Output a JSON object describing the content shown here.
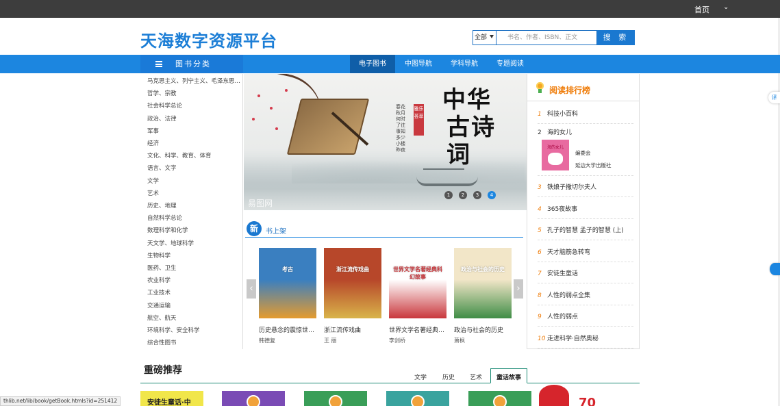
{
  "topbar": {
    "home_label": "首页",
    "menu_chevron": "⌄"
  },
  "header": {
    "logo_text": "天海数字资源平台"
  },
  "search": {
    "scope_value": "全部",
    "placeholder": "书名、作者、ISBN、正文",
    "button_label": "搜 索"
  },
  "nav": {
    "category_label": "图书分类",
    "tabs": [
      {
        "label": "电子图书",
        "active": true
      },
      {
        "label": "中图导航",
        "active": false
      },
      {
        "label": "学科导航",
        "active": false
      },
      {
        "label": "专题阅读",
        "active": false
      }
    ]
  },
  "categories": [
    "马克思主义、列宁主义、毛泽东思想、邓小平理论",
    "哲学、宗教",
    "社会科学总论",
    "政治、法律",
    "军事",
    "经济",
    "文化、科学、教育、体育",
    "语言、文字",
    "文学",
    "艺术",
    "历史、地理",
    "自然科学总论",
    "数理科学和化学",
    "天文学、地球科学",
    "生物科学",
    "医药、卫生",
    "农业科学",
    "工业技术",
    "交通运输",
    "航空、航天",
    "环境科学、安全科学",
    "综合性图书"
  ],
  "banner": {
    "title_line1": "中华",
    "title_line2": "古诗",
    "title_line3": "词",
    "seal_text": "雅乐荟萃",
    "side_text": "春花秋月何时了往事知多少小楼昨夜",
    "watermark": "昜图网",
    "slides": [
      "1",
      "2",
      "3",
      "4"
    ],
    "active_slide": 4
  },
  "new_books": {
    "badge": "新",
    "label": "书上架",
    "prev": "‹",
    "next": "›",
    "items": [
      {
        "title": "历史悬念的震惊世界的考古发现",
        "author": "韩德复",
        "cover_text": "考古",
        "colors": [
          "#3a7fc0",
          "#e59b2e"
        ]
      },
      {
        "title": "浙江流传戏曲",
        "author": "王 丽",
        "cover_text": "浙江流传戏曲",
        "colors": [
          "#b7472a",
          "#d9b44a"
        ]
      },
      {
        "title": "世界文学名著经典科幻故事",
        "author": "李剑桥",
        "cover_text": "世界文学名著经典科幻故事",
        "colors": [
          "#ffffff",
          "#c9373c"
        ]
      },
      {
        "title": "政治与社会的历史",
        "author": "萧枫",
        "cover_text": "政治与社会的历史",
        "colors": [
          "#f2e6c8",
          "#3f8d46"
        ]
      }
    ]
  },
  "ranking": {
    "title": "阅读排行榜",
    "items": [
      {
        "num": "1",
        "title": "科技小百科"
      },
      {
        "num": "2",
        "title": "海的女儿"
      },
      {
        "num": "3",
        "title": "铁娘子撒切尔夫人"
      },
      {
        "num": "4",
        "title": "365夜故事"
      },
      {
        "num": "5",
        "title": "孔子的智慧 孟子的智慧 (上)"
      },
      {
        "num": "6",
        "title": "天才脑筋急转弯"
      },
      {
        "num": "7",
        "title": "安徒生童话"
      },
      {
        "num": "8",
        "title": "人性的弱点全集"
      },
      {
        "num": "9",
        "title": "人性的弱点"
      },
      {
        "num": "10",
        "title": "走进科学·自然奥秘"
      }
    ],
    "featured": {
      "cover_text": "海的女儿",
      "editor": "编委会",
      "publisher": "延边大学出版社"
    }
  },
  "recommend": {
    "title": "重磅推荐",
    "tabs": [
      {
        "label": "文学",
        "active": false
      },
      {
        "label": "历史",
        "active": false
      },
      {
        "label": "艺术",
        "active": false
      },
      {
        "label": "童话故事",
        "active": true
      }
    ],
    "covers": [
      {
        "text": "安徒生童话·中",
        "color": "#f1e64a"
      },
      {
        "text": "",
        "color": "#7a4bb5"
      },
      {
        "text": "",
        "color": "#3a9e58"
      },
      {
        "text": "",
        "color": "#3aa39e"
      },
      {
        "text": "",
        "color": "#3a9e58"
      }
    ],
    "promo_text": "70"
  },
  "status_url": "thlib.net/lib/book/getBook.htmls?id=251412",
  "float_badge": "译"
}
